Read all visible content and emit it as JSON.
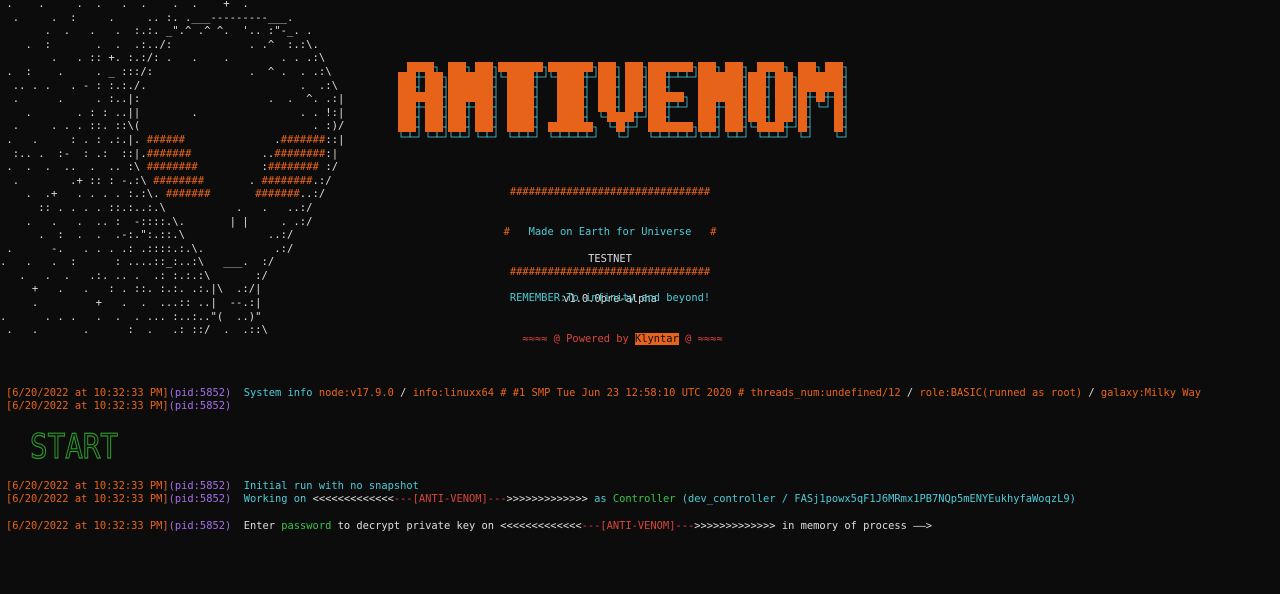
{
  "ascii_art": [
    " .    .     .  .   .  .    .  .    +  .",
    "  .     .  :     .     .. :. .___---------___.",
    "       .  .   .   .  :.:. _\".^ .^ ^.  '.. :\"-_. .",
    "    .  :       .  .  .:../:            . .^  :.:\\.",
    "        .   . :: +. :.:/: .   .    .        . . .:\\",
    " .  :    .     . _ :::/:               .  ^ .  . .:\\",
    "  .. . .   . - : :.:./.                        .  .:\\",
    "  .      .     . :..|:                    .  .  ^. .:|",
    "    .       . : : ..||        .                . . !:|",
    "  .     . . . ::. ::\\(                           . :)/",
    " .   .     : . : .:.|. ######              .#######::|",
    "  :.. .  :-  : .:  ::|.#######           ..########:|",
    " .  .  .  ..  .  .. :\\ ########          :######## :/",
    "  .        .+ :: : -.:\\ ########       . ########.:/",
    "    .  .+   . . . . :.:\\. #######       #######..:/",
    "      :: . . . . ::.:..:.\\           .   .   ..:/",
    "    .   .   .  .. :  -::::.\\.       | |     . .:/",
    "      .  :  .  .  .-:.\":.::.\\             ..:/",
    " .      -.   . . . .: .::::.:.\\.           .:/",
    ".   .   .  :      : ....::_:..:\\   ___.  :/",
    "   .   .  .   .:. .. .  .: :.:.:\\       :/",
    "     +   .   .   : . ::. :.:. .:.|\\  .:/|",
    "     .         +   .  .  ...:: ..|  --.:|",
    ".      . . .   .  .  . ... :..:..\"(  ..)\"",
    " .   .       .      :  .   .: ::/  .  .::\\"
  ],
  "logo": {
    "text": "ANTIVENOM"
  },
  "banner": {
    "hash_line": "################################",
    "hash_left": "#",
    "tagline": "Made on Earth for Universe",
    "hash_right": "#",
    "network": "TESTNET",
    "version": "v1.0.0pre-alpha",
    "remember": "REMEMBER:To infinity and beyond!",
    "powered_prefix": "≈≈≈≈ @ Powered by",
    "powered_name": "Klyntar",
    "powered_suffix": "@ ≈≈≈≈"
  },
  "colors": {
    "accent": "#e8631a",
    "cyan": "#4ec9d6",
    "purple": "#a46ee8",
    "red": "#d9453e",
    "green": "#3bc24a",
    "bg": "#0c0c0c"
  },
  "logs": {
    "timestamp": "[6/20/2022 at 10:32:33 PM]",
    "pid": "(pid:5852)",
    "sysinfo": {
      "label": "System info",
      "node": "node:v17.9.0",
      "slash1": "/",
      "info": "info:linuxx64 # #1 SMP Tue Jun 23 12:58:10 UTC 2020 # threads_num:undefined/12",
      "slash2": "/",
      "role": "role:BASIC(runned as root)",
      "slash3": "/",
      "galaxy": "galaxy:Milky Way"
    },
    "start_text": "START",
    "initial_run": "Initial run with no snapshot",
    "working": {
      "prefix": "Working on",
      "left_arrows": "<<<<<<<<<<<<<",
      "dashes_l": "---",
      "name": "[ANTI-VENOM]",
      "dashes_r": "---",
      "right_arrows": ">>>>>>>>>>>>>",
      "as": "as",
      "controller": "Controller",
      "detail": "(dev_controller / FASj1powx5qF1J6MRmx1PB7NQp5mENYEukhyfaWoqzL9)"
    },
    "enter": {
      "prefix": "Enter",
      "password": "password",
      "middle": "to decrypt private key on",
      "left_arrows": "<<<<<<<<<<<<<",
      "dashes_l": "---",
      "name": "[ANTI-VENOM]",
      "dashes_r": "---",
      "right_arrows": ">>>>>>>>>>>>>",
      "suffix": "in memory of process ——>"
    }
  }
}
